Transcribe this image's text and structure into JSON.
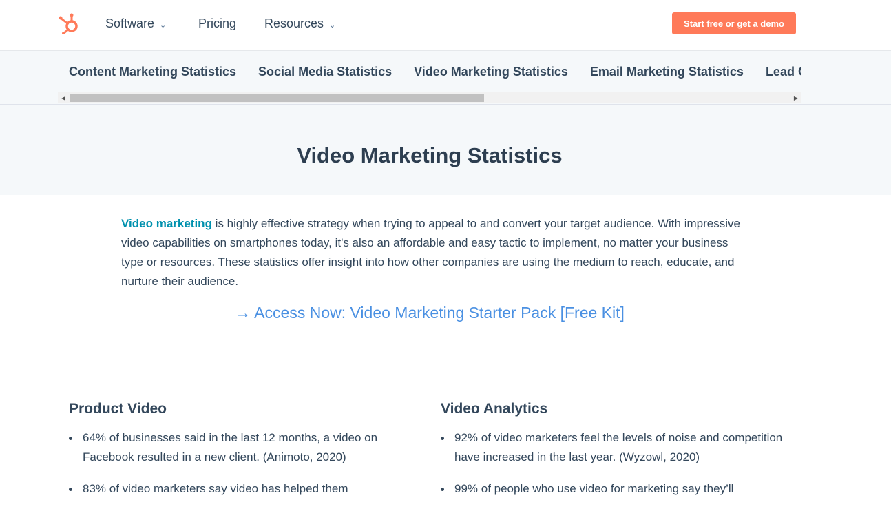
{
  "nav": {
    "logo": "hubspot-sprocket-logo",
    "items": [
      {
        "label": "Software",
        "has_dropdown": true
      },
      {
        "label": "Pricing",
        "has_dropdown": false
      },
      {
        "label": "Resources",
        "has_dropdown": true
      }
    ],
    "cta_label": "Start free or get a demo",
    "accent_color": "#ff7a59"
  },
  "subnav": {
    "items": [
      "Content Marketing Statistics",
      "Social Media Statistics",
      "Video Marketing Statistics",
      "Email Marketing Statistics",
      "Lead Generation Statistics"
    ],
    "scroll_fraction_visible": 0.56
  },
  "hero": {
    "title": "Video Marketing Statistics"
  },
  "intro": {
    "link_text": "Video marketing",
    "text": " is highly effective strategy when trying to appeal to and convert your target audience. With impressive video capabilities on smartphones today, it's also an affordable and easy tactic to implement, no matter your business type or resources. These statistics offer insight into how other companies are using the medium to reach, educate, and nurture their audience."
  },
  "access_link": "→ Access Now: Video Marketing Starter Pack [Free Kit]",
  "sections": [
    {
      "title": "Product Video",
      "bullets": [
        "64% of businesses said in the last 12 months, a video on Facebook resulted in a new client. (Animoto, 2020)",
        "83% of video marketers say video has helped them"
      ]
    },
    {
      "title": "Video Analytics",
      "bullets": [
        "92% of video marketers feel the levels of noise and competition have increased in the last year. (Wyzowl, 2020)",
        "99% of people who use video for marketing say they’ll"
      ]
    }
  ]
}
